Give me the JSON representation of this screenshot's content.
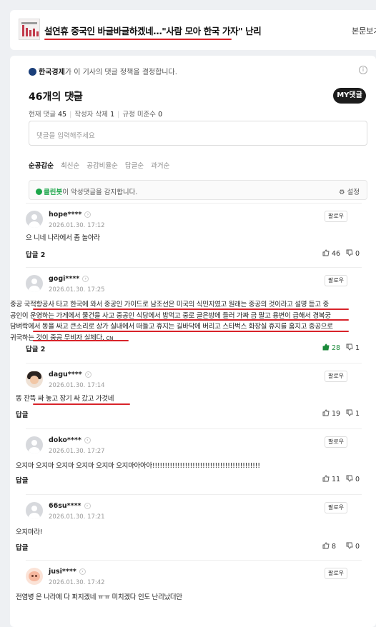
{
  "article": {
    "title": "설연휴 중국인 바글바글하겠네…\"사람 모아 한국 가자\" 난리",
    "read_body_label": "본문보기"
  },
  "policy": {
    "publisher": "한국경제",
    "text": "가 이 기사의 댓글 정책을 결정합니다."
  },
  "comments_header": {
    "count_title": "46개의 댓글",
    "my_comments_label": "MY댓글",
    "current_label": "현재 댓글",
    "current_value": "45",
    "author_deleted_label": "작성자 삭제",
    "author_deleted_value": "1",
    "rule_violation_label": "규정 미준수",
    "rule_violation_value": "0"
  },
  "input": {
    "placeholder": "댓글을 입력해주세요"
  },
  "sort_tabs": [
    "순공감순",
    "최신순",
    "공감비율순",
    "답글순",
    "과거순"
  ],
  "cleanbot": {
    "name": "클린봇",
    "text": "이 악성댓글을 감지합니다.",
    "setting_label": "설정"
  },
  "follow_label": "팔로우",
  "comments": [
    {
      "nickname": "hope****",
      "date": "2026.01.30. 17:12",
      "text": "으 니네 나라에서 좀 놀아라",
      "reply": "답글 2",
      "likes": "46",
      "dislikes": "0"
    },
    {
      "nickname": "gogi****",
      "date": "2026.01.30. 17:25",
      "lines": [
        "중공 국적항공사 타고 한국에 와서 중공인 가이드로 남조선은 미국의 식민지였고 원래는 중공의 것이라고 설명 듣고 중",
        "공인이 운영하는 가게에서 물건을 사고 중공인 식당에서 밥먹고 중로 글은방에 들러 가짜 금 팔고 용변이 급해서 경복궁",
        "담벼락에서 똥을 싸고 큰소리로 상가 실내에서 떠들고 휴지는 길바닥에 버리고 스타벅스 화장실 휴지를 훔치고 중공으로",
        "귀국하는 것이 중공 무비자 실체다."
      ],
      "suffix": "CN",
      "reply": "답글 2",
      "likes": "28",
      "dislikes": "1"
    },
    {
      "nickname": "dagu****",
      "date": "2026.01.30. 17:14",
      "text": "똥 잔뜩 싸 놓고 장기 싸 갔고 가것네",
      "reply": "답글",
      "likes": "19",
      "dislikes": "1"
    },
    {
      "nickname": "doko****",
      "date": "2026.01.30. 17:27",
      "text": "오지마 오지마 오지마 오지마 오지마 오지마아아아!!!!!!!!!!!!!!!!!!!!!!!!!!!!!!!!!!!!!!!!!!!",
      "reply": "답글",
      "likes": "11",
      "dislikes": "0"
    },
    {
      "nickname": "66su****",
      "date": "2026.01.30. 17:21",
      "text": "오지마라!",
      "reply": "답글",
      "likes": "8",
      "dislikes": "0"
    },
    {
      "nickname": "jusi****",
      "date": "2026.01.30. 17:42",
      "text": "전염병 온 나라에 다 퍼지겠네 ㅠㅠ 미치겠다 인도 난리났더만"
    }
  ],
  "colors": {
    "underline": "#d8232a",
    "liked_green": "#1b8a3a",
    "cleanbot_green": "#1ca64a"
  }
}
